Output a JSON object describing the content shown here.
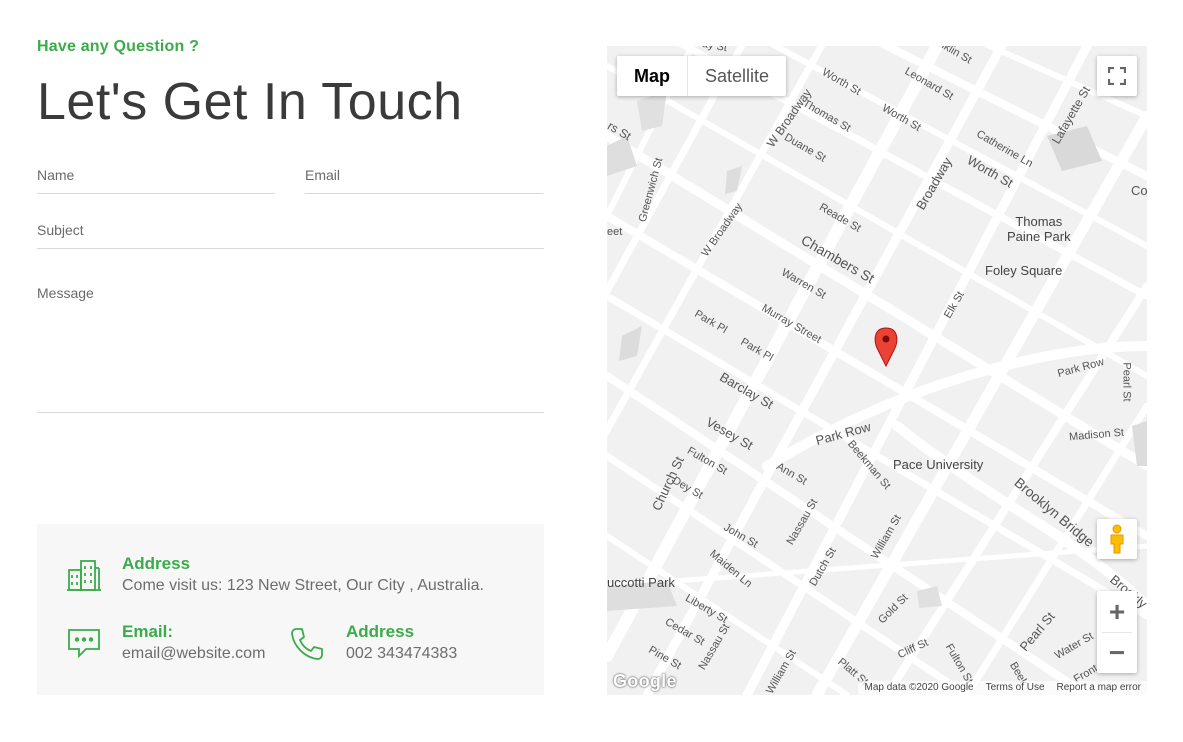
{
  "contact": {
    "eyebrow": "Have any Question ?",
    "title": "Let's Get In Touch",
    "form": {
      "name_placeholder": "Name",
      "email_placeholder": "Email",
      "subject_placeholder": "Subject",
      "message_placeholder": "Message"
    },
    "info": {
      "address_label": "Address",
      "address_value": "Come visit us: 123 New Street, Our City , Australia.",
      "email_label": "Email:",
      "email_value": "email@website.com",
      "phone_label": "Address",
      "phone_value": "002 343474383"
    },
    "colors": {
      "accent": "#3aac4a",
      "title": "#3a3a3a",
      "info_bg": "#f7f7f7"
    }
  },
  "map": {
    "type_map": "Map",
    "type_satellite": "Satellite",
    "zoom_in": "+",
    "zoom_out": "−",
    "logo": "Google",
    "footer": {
      "data": "Map data ©2020 Google",
      "terms": "Terms of Use",
      "report": "Report a map error"
    },
    "places": {
      "thomas_paine": "Thomas\nPaine Park",
      "foley": "Foley Square",
      "pace": "Pace University",
      "tucciotti": "uccotti Park"
    },
    "streets": {
      "worth1": "Worth St",
      "leonard": "Leonard St",
      "w_broadway_top": "W Broadway",
      "thomas_st": "Thomas St",
      "worth2": "Worth St",
      "catherine": "Catherine Ln",
      "lafayette": "Lafayette St",
      "duane": "Duane St",
      "worth3": "Worth St",
      "broadway": "Broadway",
      "greenwich": "Greenwich St",
      "reade": "Reade St",
      "w_broadway": "W Broadway",
      "chambers": "Chambers St",
      "warren": "Warren St",
      "murray": "Murray Street",
      "park_pl1": "Park Pl",
      "park_pl2": "Park Pl",
      "elk": "Elk St",
      "park_row_r": "Park Row",
      "pearl": "Pearl St",
      "barclay": "Barclay St",
      "vesey": "Vesey St",
      "park_row": "Park Row",
      "madison": "Madison St",
      "fulton": "Fulton St",
      "ann": "Ann St",
      "beekman": "Beekman St",
      "church": "Church St",
      "dey": "Dey St",
      "brooklyn_bridge": "Brooklyn Bridge",
      "john": "John St",
      "nassau": "Nassau St",
      "william": "William St",
      "maiden": "Maiden Ln",
      "dutch": "Dutch St",
      "liberty": "Liberty St",
      "cedar": "Cedar St",
      "nassau2": "Nassau St",
      "gold": "Gold St",
      "pearl2": "Pearl St",
      "cliff": "Cliff St",
      "water": "Water St",
      "pine": "Pine St",
      "william2": "William St",
      "platt": "Platt St",
      "fulton2": "Fulton St",
      "front": "Front",
      "beek2": "Beek",
      "rs_st": "rs St",
      "eet": "eet",
      "co": "Co",
      "franklin": "nklin St",
      "ay_st": "ay St",
      "brookly": "Brookly"
    }
  }
}
